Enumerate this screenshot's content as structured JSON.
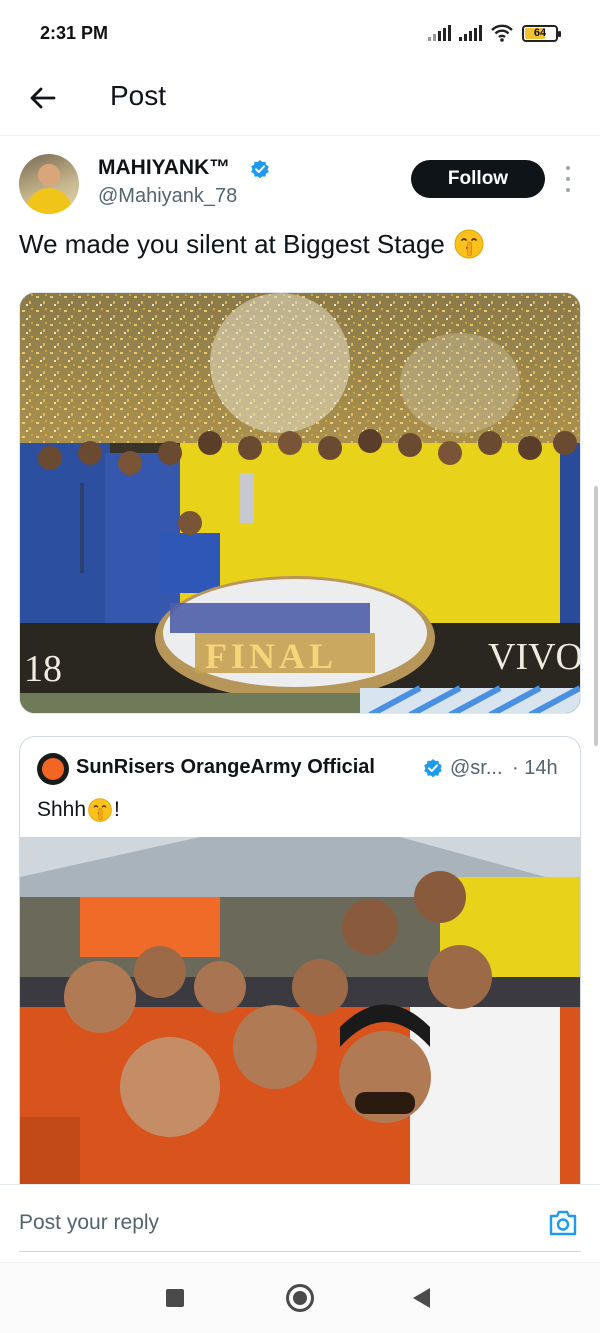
{
  "status_bar": {
    "time": "2:31 PM",
    "battery": "64",
    "icons": [
      "signal-icon",
      "signal-icon",
      "wifi-icon",
      "battery-icon"
    ]
  },
  "header": {
    "title": "Post",
    "back_icon": "arrow-left-icon"
  },
  "post": {
    "author_name": "MAHIYANK™",
    "author_handle": "@Mahiyank_78",
    "verified": true,
    "follow_label": "Follow",
    "text": "We made you silent at Biggest Stage",
    "emoji": "shushing-face-emoji",
    "photo_text": {
      "banner_left": "18",
      "banner_right": "VIVO",
      "trophy_stand": "FINAL"
    }
  },
  "quoted_post": {
    "author_name": "SunRisers OrangeArmy Official",
    "author_handle": "@sr...",
    "time": "· 14h",
    "verified": true,
    "text_before_emoji": "Shhh",
    "text_after_emoji": "!"
  },
  "reply": {
    "placeholder": "Post your reply",
    "camera_icon": "camera-icon"
  },
  "nav": {
    "icons": [
      "recents-icon",
      "home-icon",
      "back-icon"
    ]
  },
  "colors": {
    "accent": "#1d9bf0",
    "text": "#0f1419",
    "muted": "#536471",
    "follow_bg": "#0f1419",
    "csk_yellow": "#f2d21b",
    "srh_orange": "#f26522"
  }
}
